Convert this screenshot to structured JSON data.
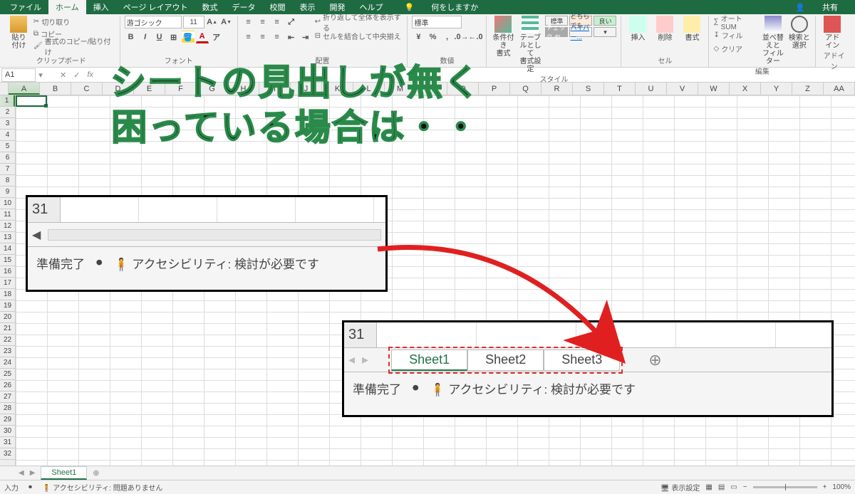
{
  "tabs": {
    "file": "ファイル",
    "home": "ホーム",
    "insert": "挿入",
    "pagelayout": "ページ レイアウト",
    "formulas": "数式",
    "data": "データ",
    "review": "校閲",
    "view": "表示",
    "developer": "開発",
    "help": "ヘルプ",
    "tellme": "何をしますか",
    "share": "共有"
  },
  "ribbon": {
    "clipboard": {
      "paste": "貼り\n付け",
      "cut": "切り取り",
      "copy": "コピー",
      "format_painter": "書式のコピー/貼り付け",
      "label": "クリップボード"
    },
    "font": {
      "name": "游ゴシック",
      "size": "11",
      "bold": "B",
      "italic": "I",
      "underline": "U",
      "label": "フォント"
    },
    "alignment": {
      "wrap": "折り返して全体を表示する",
      "merge": "セルを結合して中央揃え",
      "label": "配置"
    },
    "number": {
      "format": "標準",
      "label": "数値"
    },
    "styles": {
      "cond": "条件付き\n書式",
      "tbl": "テーブルとして\n書式設定",
      "std": "標準",
      "bad": "どちらでも...",
      "good": "良い",
      "check": "チェック セ...",
      "link": "ハイパー...",
      "label": "スタイル"
    },
    "cells": {
      "insert": "挿入",
      "delete": "削除",
      "format": "書式",
      "label": "セル"
    },
    "editing": {
      "autosum": "オート SUM",
      "fill": "フィル",
      "clear": "クリア",
      "sort": "並べ替えと\nフィルター",
      "find": "検索と\n選択",
      "label": "編集"
    },
    "addins": {
      "addin": "アド\nイン",
      "label": "アドイン"
    }
  },
  "namebox": "A1",
  "fx": "fx",
  "columns": [
    "A",
    "B",
    "C",
    "D",
    "E",
    "F",
    "G",
    "H",
    "I",
    "J",
    "K",
    "L",
    "M",
    "N",
    "O",
    "P",
    "Q",
    "R",
    "S",
    "T",
    "U",
    "V",
    "W",
    "X",
    "Y",
    "Z",
    "AA"
  ],
  "rowcount": 32,
  "sheet": {
    "name": "Sheet1",
    "navleft": "◀",
    "navright": "▶",
    "plus": "⊕"
  },
  "status": {
    "mode": "入力",
    "acc": "アクセシビリティ: 問題ありません",
    "display": "表示設定",
    "zoom": "100%"
  },
  "overlay": {
    "line1": "シートの見出しが無く",
    "line2": "困っている場合は・・"
  },
  "callout": {
    "rownum": "31",
    "ready": "準備完了",
    "acc_long": "アクセシビリティ: 検討が必要です",
    "sheets": [
      "Sheet1",
      "Sheet2",
      "Sheet3"
    ],
    "navleft": "◂",
    "navright": "▸",
    "tri": "◀",
    "plus": "⊕"
  }
}
